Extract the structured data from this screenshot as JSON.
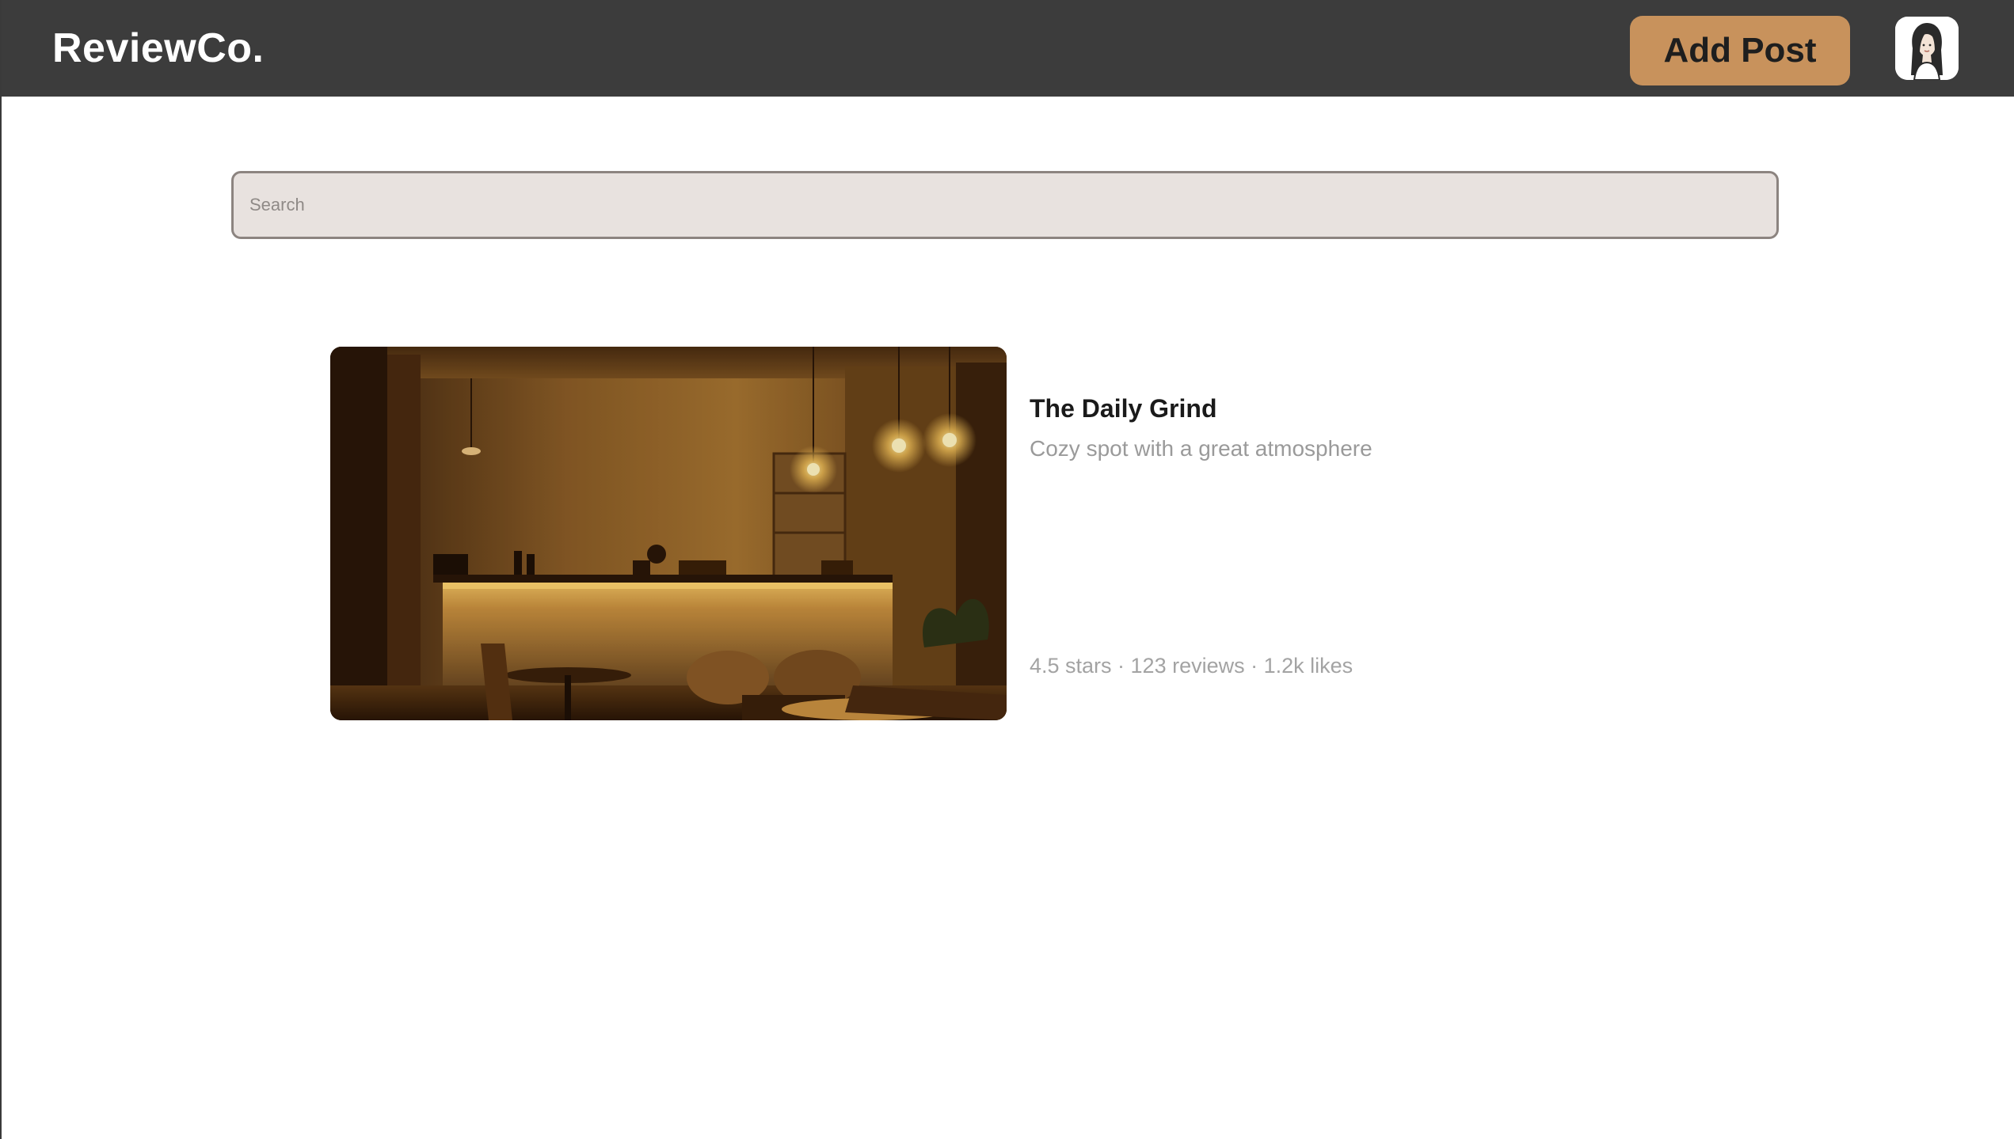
{
  "header": {
    "brand": "ReviewCo.",
    "add_post_label": "Add Post",
    "avatar_icon": "user-avatar-icon",
    "background": "#3c3c3c",
    "accent": "#c8925c"
  },
  "search": {
    "placeholder": "Search",
    "value": ""
  },
  "posts": [
    {
      "image": "cafe-interior-photo",
      "title": "The Daily Grind",
      "description": "Cozy spot with a great atmosphere",
      "stats": "4.5 stars · 123 reviews · 1.2k likes"
    }
  ]
}
